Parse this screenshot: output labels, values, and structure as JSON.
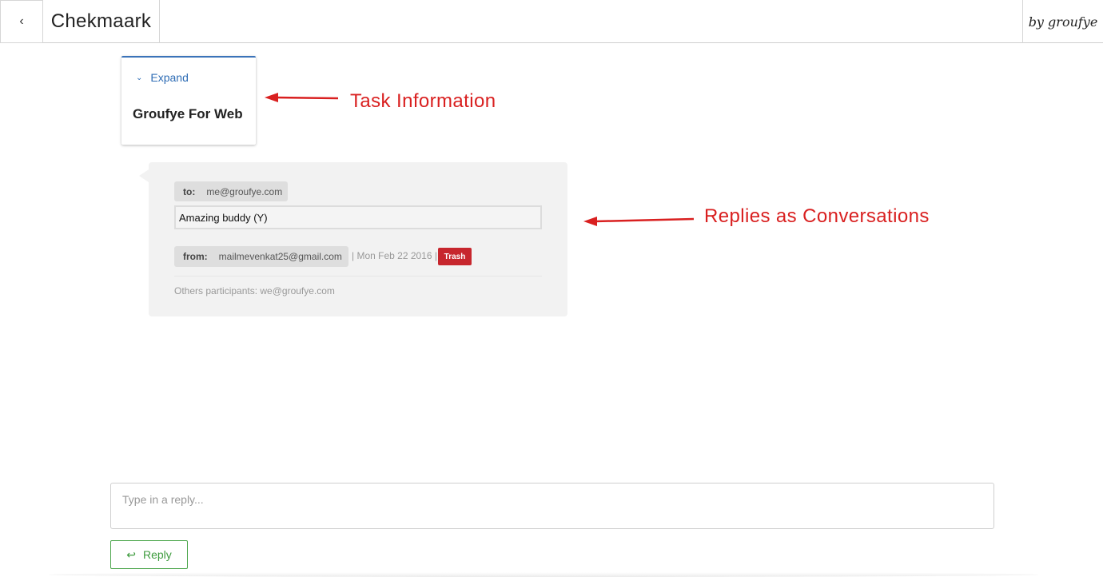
{
  "header": {
    "back_icon": "chevron-left-icon",
    "back_glyph": "‹",
    "app_title": "Chekmaark",
    "byline": "by groufye"
  },
  "task": {
    "expand_icon": "chevron-down-icon",
    "expand_glyph": "⌄",
    "expand_label": "Expand",
    "title": "Groufye For Web"
  },
  "annotations": {
    "task_label": "Task Information",
    "replies_label": "Replies as Conversations",
    "color": "#d92020"
  },
  "conversation": {
    "to_key": "to:",
    "to_value": "me@groufye.com",
    "message": "Amazing buddy (Y)",
    "from_key": "from:",
    "from_value": "mailmevenkat25@gmail.com",
    "meta": "| Mon Feb 22 2016 |",
    "trash_label": "Trash",
    "participants": "Others participants: we@groufye.com"
  },
  "reply": {
    "placeholder": "Type in a reply...",
    "button_icon": "reply-icon",
    "button_glyph": "↩",
    "button_label": "Reply"
  },
  "colors": {
    "accent_blue": "#2f6db5",
    "trash_red": "#c7262d",
    "reply_green": "#3e9b3e"
  }
}
